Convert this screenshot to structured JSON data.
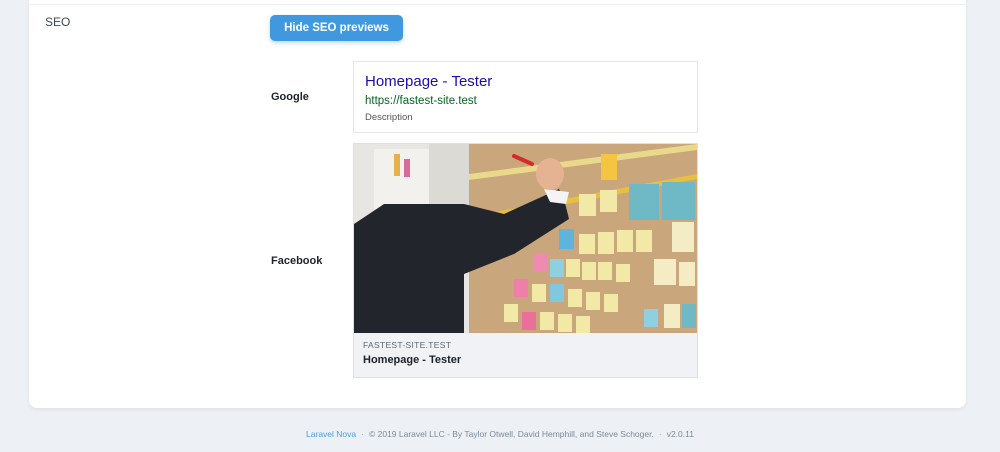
{
  "seo": {
    "field_label": "SEO",
    "toggle_button_label": "Hide SEO previews",
    "google_label": "Google",
    "facebook_label": "Facebook"
  },
  "google_preview": {
    "title": "Homepage - Tester",
    "url": "https://fastest-site.test",
    "description": "Description"
  },
  "facebook_preview": {
    "domain": "FASTEST-SITE.TEST",
    "title": "Homepage - Tester"
  },
  "footer": {
    "link_text": "Laravel Nova",
    "sep": "·",
    "copyright": "© 2019 Laravel LLC - By Taylor Otwell, David Hemphill, and Steve Schoger.",
    "version": "v2.0.11"
  },
  "colors": {
    "accent": "#4099de",
    "google_title": "#1a0dab",
    "google_url": "#006621",
    "page_bg": "#edf0f4"
  }
}
